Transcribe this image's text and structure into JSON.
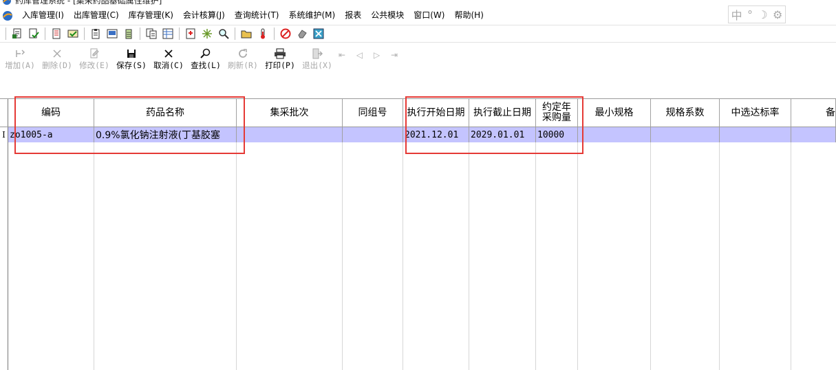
{
  "window": {
    "title": "药库管理系统 - [集采药品基础属性维护]"
  },
  "menu": {
    "items": [
      "入库管理(I)",
      "出库管理(C)",
      "库存管理(K)",
      "会计核算(J)",
      "查询统计(T)",
      "系统维护(M)",
      "报表",
      "公共模块",
      "窗口(W)",
      "帮助(H)"
    ]
  },
  "ime": {
    "mode_label": "中",
    "punct_label": "°",
    "moon_label": "☽",
    "gear_label": "⚙"
  },
  "toolbar": {
    "buttons": [
      {
        "label": "增加(A)",
        "icon": "add-icon",
        "enabled": false
      },
      {
        "label": "删除(D)",
        "icon": "delete-icon",
        "enabled": false
      },
      {
        "label": "修改(E)",
        "icon": "edit-icon",
        "enabled": false
      },
      {
        "label": "保存(S)",
        "icon": "save-icon",
        "enabled": true
      },
      {
        "label": "取消(C)",
        "icon": "cancel-icon",
        "enabled": true
      },
      {
        "label": "查找(L)",
        "icon": "find-icon",
        "enabled": true
      },
      {
        "label": "刷新(R)",
        "icon": "refresh-icon",
        "enabled": false
      },
      {
        "label": "打印(P)",
        "icon": "print-icon",
        "enabled": true
      },
      {
        "label": "退出(X)",
        "icon": "exit-icon",
        "enabled": false
      }
    ],
    "nav_arrows": "⇤ ◁ ▷ ⇥"
  },
  "grid": {
    "columns": [
      "编码",
      "药品名称",
      "集采批次",
      "同组号",
      "执行开始日期",
      "执行截止日期",
      "约定年\n采购量",
      "最小规格",
      "规格系数",
      "中选达标率",
      "备"
    ],
    "rows": [
      {
        "indicator": "I",
        "cells": [
          "zo1005-a",
          "0.9%氯化钠注射液(丁基胶塞",
          "",
          "",
          "2021.12.01",
          "2029.01.01",
          "10000",
          "",
          "",
          "",
          ""
        ]
      }
    ]
  },
  "colors": {
    "selected_row": "#c4c4ff",
    "highlight_box": "#e53935"
  }
}
